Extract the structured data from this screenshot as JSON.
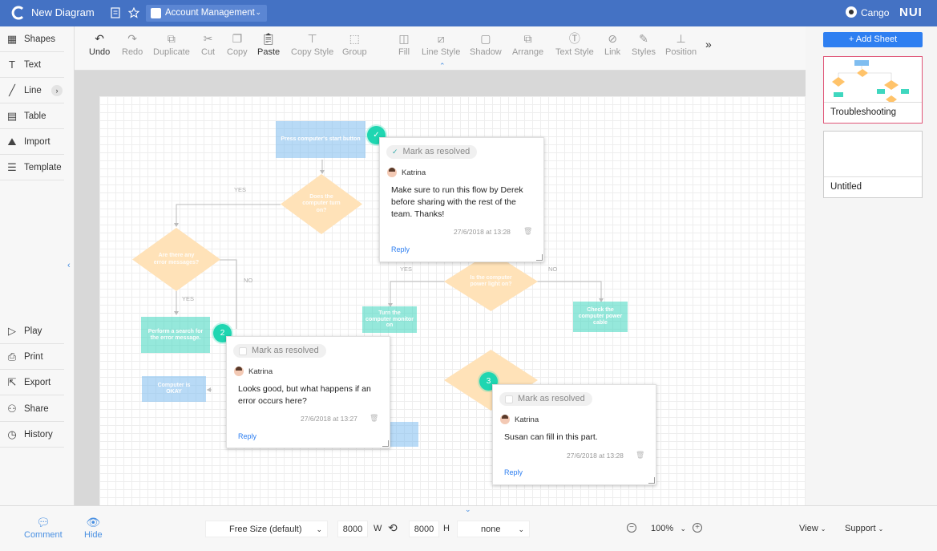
{
  "app": {
    "title": "New Diagram",
    "folder": "Account Management",
    "user": "Cango",
    "brand": "NUI"
  },
  "sidebar": {
    "items": [
      {
        "label": "Shapes",
        "icon": "shapes-icon"
      },
      {
        "label": "Text",
        "icon": "text-icon"
      },
      {
        "label": "Line",
        "icon": "line-icon"
      },
      {
        "label": "Table",
        "icon": "table-icon"
      },
      {
        "label": "Import",
        "icon": "import-icon"
      },
      {
        "label": "Template",
        "icon": "template-icon"
      }
    ],
    "bottom_items": [
      {
        "label": "Play",
        "icon": "play-icon"
      },
      {
        "label": "Print",
        "icon": "print-icon"
      },
      {
        "label": "Export",
        "icon": "export-icon"
      },
      {
        "label": "Share",
        "icon": "share-icon"
      },
      {
        "label": "History",
        "icon": "history-icon"
      }
    ]
  },
  "toolbar": {
    "buttons": [
      "Undo",
      "Redo",
      "Duplicate",
      "Cut",
      "Copy",
      "Paste",
      "Copy Style",
      "Group",
      "Fill",
      "Line Style",
      "Shadow",
      "Arrange",
      "Text Style",
      "Link",
      "Styles",
      "Position"
    ],
    "more": "»"
  },
  "sheets": {
    "add_label": "+ Add Sheet",
    "items": [
      {
        "name": "Troubleshooting"
      },
      {
        "name": "Untitled"
      }
    ]
  },
  "diagram": {
    "start": "Press computer's start button",
    "q1": "Does the computer turn on?",
    "q2": "Are there any error messages?",
    "q3": "Is the computer power light on?",
    "search": "Perform a search for the error message.",
    "okay": "Computer is OKAY",
    "monitor": "Turn the computer monitor on",
    "cable": "Check the computer power cable",
    "yes1": "YES",
    "no1": "NO",
    "yes2": "YES",
    "yes3": "YES",
    "no3": "NO"
  },
  "comments": [
    {
      "badge": "✓",
      "mark": "Mark as resolved",
      "user": "Katrina",
      "text": "Make sure to run this flow by Derek before sharing with the rest of the team. Thanks!",
      "date": "27/6/2018 at 13:28",
      "reply": "Reply"
    },
    {
      "badge": "2",
      "mark": "Mark as resolved",
      "user": "Katrina",
      "text": "Looks good, but what happens if an error occurs here?",
      "date": "27/6/2018 at 13:27",
      "reply": "Reply"
    },
    {
      "badge": "3",
      "mark": "Mark as resolved",
      "user": "Katrina",
      "text": "Susan can fill in this part.",
      "date": "27/6/2018 at 13:28",
      "reply": "Reply"
    }
  ],
  "bottom": {
    "comment": "Comment",
    "hide": "Hide",
    "size": "Free Size (default)",
    "width": "8000",
    "w": "W",
    "height": "8000",
    "h": "H",
    "orientation": "none",
    "zoom": "100%",
    "view": "View",
    "support": "Support"
  },
  "colors": {
    "header": "#4472c4",
    "accent": "#2e7ff1",
    "badge": "#1fd6b1",
    "active_sheet": "#e05577"
  }
}
